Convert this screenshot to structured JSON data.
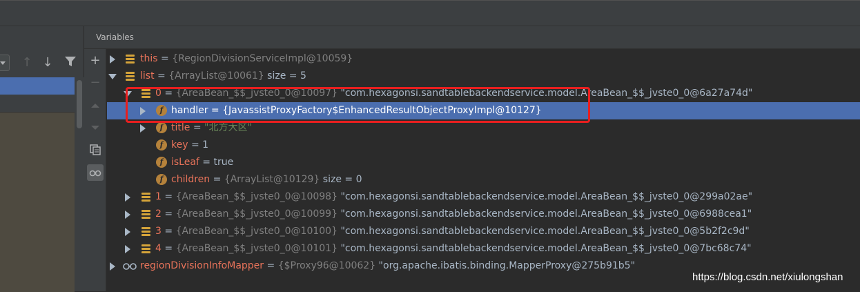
{
  "panel": {
    "title": "Variables"
  },
  "left_toolbar": {
    "icons": [
      "dropdown-arrow-icon",
      "arrow-up-icon",
      "arrow-down-icon",
      "filter-icon"
    ]
  },
  "vars_toolbar": {
    "icons": [
      "plus-icon",
      "minus-icon",
      "move-up-icon",
      "move-down-icon",
      "copy-icon",
      "glasses-icon"
    ]
  },
  "tree": {
    "rows": [
      {
        "name": "this",
        "eq": " = ",
        "id": "{RegionDivisionServiceImpl@10059}",
        "value": ""
      },
      {
        "name": "list",
        "eq": " = ",
        "id": "{ArrayList@10061}",
        "value": " size = 5"
      },
      {
        "name": "0",
        "eq": " = ",
        "id": "{AreaBean_$$_jvste0_0@10097}",
        "value": " \"com.hexagonsi.sandtablebackendservice.model.AreaBean_$$_jvste0_0@6a27a74d\""
      },
      {
        "name": "handler",
        "eq": " = ",
        "id": "{JavassistProxyFactory$EnhancedResultObjectProxyImpl@10127}",
        "value": ""
      },
      {
        "name": "title",
        "eq": " = ",
        "id": "",
        "value": "\"北方大区\""
      },
      {
        "name": "key",
        "eq": " = ",
        "id": "",
        "value": "1"
      },
      {
        "name": "isLeaf",
        "eq": " = ",
        "id": "",
        "value": "true"
      },
      {
        "name": "children",
        "eq": " = ",
        "id": "{ArrayList@10129}",
        "value": " size = 0"
      },
      {
        "name": "1",
        "eq": " = ",
        "id": "{AreaBean_$$_jvste0_0@10098}",
        "value": " \"com.hexagonsi.sandtablebackendservice.model.AreaBean_$$_jvste0_0@299a02ae\""
      },
      {
        "name": "2",
        "eq": " = ",
        "id": "{AreaBean_$$_jvste0_0@10099}",
        "value": " \"com.hexagonsi.sandtablebackendservice.model.AreaBean_$$_jvste0_0@6988cea1\""
      },
      {
        "name": "3",
        "eq": " = ",
        "id": "{AreaBean_$$_jvste0_0@10100}",
        "value": " \"com.hexagonsi.sandtablebackendservice.model.AreaBean_$$_jvste0_0@5b2f2c9d\""
      },
      {
        "name": "4",
        "eq": " = ",
        "id": "{AreaBean_$$_jvste0_0@10101}",
        "value": " \"com.hexagonsi.sandtablebackendservice.model.AreaBean_$$_jvste0_0@7bc68c74\""
      },
      {
        "name": "regionDivisionInfoMapper",
        "eq": " = ",
        "id": "{$Proxy96@10062}",
        "value": " \"org.apache.ibatis.binding.MapperProxy@275b91b5\""
      }
    ]
  },
  "watermark": "https://blog.csdn.net/xiulongshan",
  "colors": {
    "selection": "#4b6eaf",
    "highlight_box": "#e81f1f",
    "field_name": "#e8735a",
    "string_value": "#6a8759"
  }
}
